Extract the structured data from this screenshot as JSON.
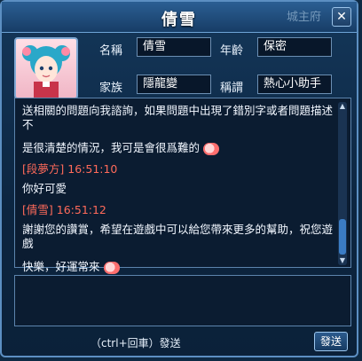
{
  "window": {
    "title": "倩雪",
    "background_hint": "城主府"
  },
  "profile": {
    "name_label": "名稱",
    "name_value": "倩雪",
    "age_label": "年齡",
    "age_value": "保密",
    "clan_label": "家族",
    "clan_value": "隱龍變",
    "title_label": "稱謂",
    "title_value": "熱心小助手"
  },
  "chat": {
    "lines": [
      {
        "text": "送相關的問題向我諮詢，如果問題中出現了錯別字或者問題描述不"
      },
      {
        "text": "是很清楚的情況，我可是會很爲難的"
      },
      {
        "speaker": "[段夢方]",
        "time": "16:51:10"
      },
      {
        "text": "你好可愛"
      },
      {
        "speaker": "[倩雪]",
        "time": "16:51:12"
      },
      {
        "text": "謝謝您的讚賞，希望在遊戲中可以給您帶來更多的幫助，祝您遊戲"
      },
      {
        "text": "快樂，好運常來"
      }
    ]
  },
  "footer": {
    "hint": "（ctrl+回車）發送",
    "send_label": "發送"
  }
}
